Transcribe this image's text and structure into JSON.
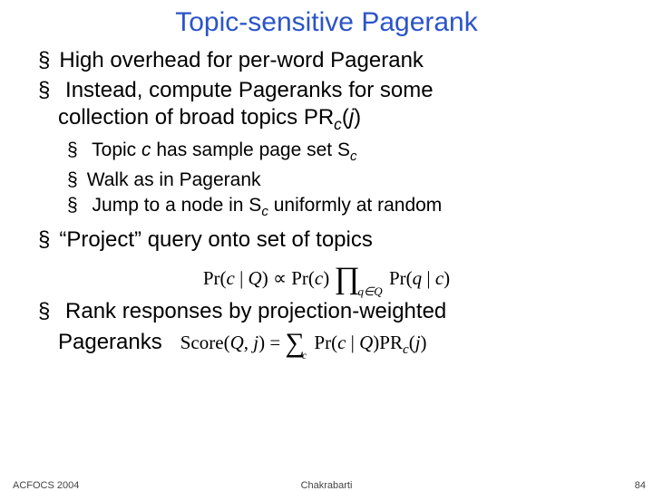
{
  "title": "Topic-sensitive Pagerank",
  "bullets": {
    "b1": "High overhead for per-word Pagerank",
    "b2_a": "Instead, compute Pageranks for some",
    "b2_b": "collection of broad topics PR",
    "b2_sub": "c",
    "b2_c": "(",
    "b2_j": "j",
    "b2_d": ")",
    "sub1_a": "Topic ",
    "sub1_c": "c",
    "sub1_b": " has sample page set S",
    "sub1_sub": "c",
    "sub2": "Walk as in Pagerank",
    "sub3_a": "Jump to a node in S",
    "sub3_sub": "c",
    "sub3_b": " uniformly at random",
    "b3": "“Project” query onto set of topics",
    "b4_a": "Rank responses by projection-weighted",
    "b4_b": "Pageranks"
  },
  "formula1": {
    "text": "Pr(c | Q) ∝ Pr(c) ∏ Pr(q | c)",
    "sub": "q∈Q"
  },
  "formula2": {
    "text": "Score(Q, j) = ∑ Pr(c | Q) PR (j)",
    "sub": "c",
    "prsub": "c"
  },
  "footer": {
    "left": "ACFOCS 2004",
    "center": "Chakrabarti",
    "right": "84"
  }
}
